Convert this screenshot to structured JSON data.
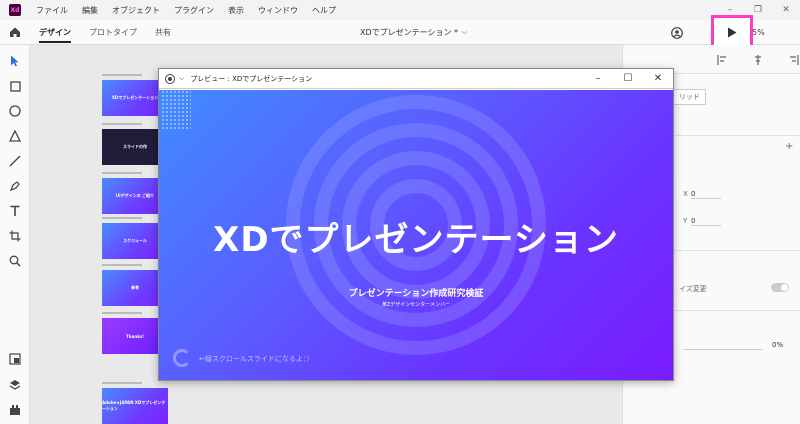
{
  "menubar": {
    "app_logo": "Xd",
    "items": [
      "ファイル",
      "編集",
      "オブジェクト",
      "プラグイン",
      "表示",
      "ウィンドウ",
      "ヘルプ"
    ]
  },
  "toolbar": {
    "tabs": [
      "デザイン",
      "プロトタイプ",
      "共有"
    ],
    "doc_title": "XDでプレゼンテーション *",
    "zoom": "5%"
  },
  "canvas": {
    "thumbs": [
      {
        "label": "XDでプレゼンテーション"
      },
      {
        "label": "スライドの作"
      },
      {
        "label": "UIデザインの ご紹介"
      },
      {
        "label": "スケジュール"
      },
      {
        "label": "参考"
      },
      {
        "label": "Thanks!"
      },
      {
        "label": "Adobe★JAPAN XDでプレゼンテーション"
      }
    ]
  },
  "rightpanel": {
    "grid_label": "リッド",
    "x_label": "X",
    "x_value": "0",
    "y_label": "Y",
    "y_value": "0",
    "resize_label": "イズ変更",
    "opacity_value": "0%"
  },
  "preview": {
    "window_title": "プレビュー : XDでプレゼンテーション",
    "slide_title": "XDでプレゼンテーション",
    "slide_subtitle": "プレゼンテーション作成研究検証",
    "slide_author": "某Zデザインセンターメンバー",
    "slide_hint": "←縦スクロールスライドになるよ：）"
  },
  "colors": {
    "highlight": "#ff3cc8",
    "slide_start": "#3f8cff",
    "slide_end": "#7a1cff"
  }
}
